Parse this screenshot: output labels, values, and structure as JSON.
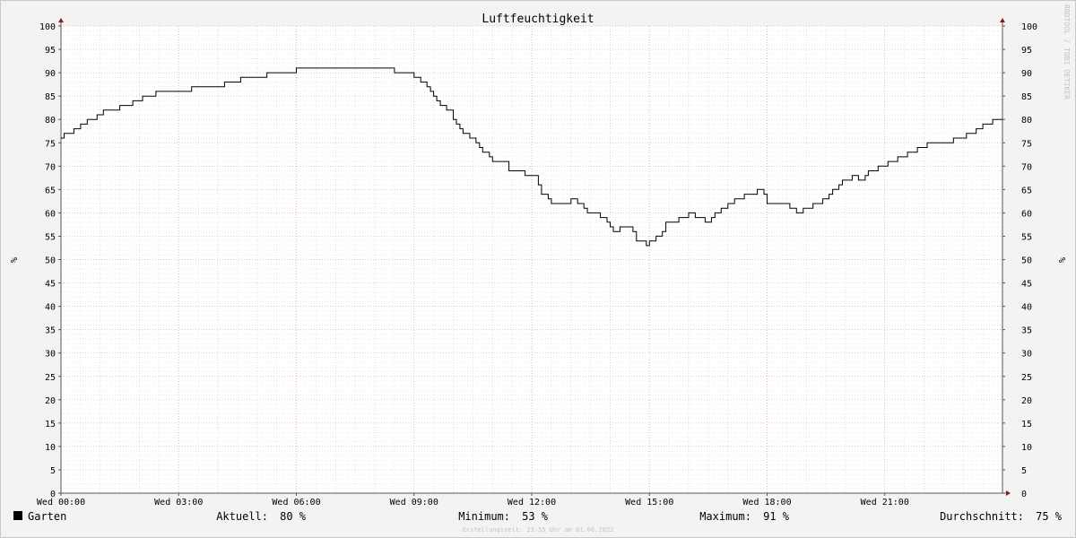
{
  "chart_data": {
    "type": "line",
    "title": "Luftfeuchtigkeit",
    "ylabel": "%",
    "ylabel_right": "%",
    "watermark": "RRDTOOL / TOBI OETIKER",
    "ylim": [
      0,
      100
    ],
    "y_ticks": [
      0,
      5,
      10,
      15,
      20,
      25,
      30,
      35,
      40,
      45,
      50,
      55,
      60,
      65,
      70,
      75,
      80,
      85,
      90,
      95,
      100
    ],
    "xlim_hours": [
      0,
      24
    ],
    "x_ticks": [
      {
        "label": "Wed 00:00",
        "hour": 0
      },
      {
        "label": "Wed 03:00",
        "hour": 3
      },
      {
        "label": "Wed 06:00",
        "hour": 6
      },
      {
        "label": "Wed 09:00",
        "hour": 9
      },
      {
        "label": "Wed 12:00",
        "hour": 12
      },
      {
        "label": "Wed 15:00",
        "hour": 15
      },
      {
        "label": "Wed 18:00",
        "hour": 18
      },
      {
        "label": "Wed 21:00",
        "hour": 21
      }
    ],
    "grid": true,
    "series": [
      {
        "name": "Garten",
        "color": "#000000",
        "points": [
          [
            0.0,
            76
          ],
          [
            0.08,
            77
          ],
          [
            0.33,
            78
          ],
          [
            0.5,
            79
          ],
          [
            0.67,
            80
          ],
          [
            0.92,
            81
          ],
          [
            1.08,
            82
          ],
          [
            1.5,
            83
          ],
          [
            1.83,
            84
          ],
          [
            2.08,
            85
          ],
          [
            2.42,
            86
          ],
          [
            3.33,
            87
          ],
          [
            4.17,
            88
          ],
          [
            4.58,
            89
          ],
          [
            5.25,
            90
          ],
          [
            6.0,
            91
          ],
          [
            8.5,
            90
          ],
          [
            9.0,
            89
          ],
          [
            9.17,
            88
          ],
          [
            9.33,
            87
          ],
          [
            9.42,
            86
          ],
          [
            9.5,
            85
          ],
          [
            9.58,
            84
          ],
          [
            9.67,
            83
          ],
          [
            9.83,
            82
          ],
          [
            10.0,
            80
          ],
          [
            10.08,
            79
          ],
          [
            10.17,
            78
          ],
          [
            10.25,
            77
          ],
          [
            10.42,
            76
          ],
          [
            10.58,
            75
          ],
          [
            10.67,
            74
          ],
          [
            10.75,
            73
          ],
          [
            10.92,
            72
          ],
          [
            11.0,
            71
          ],
          [
            11.42,
            69
          ],
          [
            11.83,
            68
          ],
          [
            12.17,
            66
          ],
          [
            12.25,
            64
          ],
          [
            12.42,
            63
          ],
          [
            12.5,
            62
          ],
          [
            13.0,
            63
          ],
          [
            13.17,
            62
          ],
          [
            13.33,
            61
          ],
          [
            13.42,
            60
          ],
          [
            13.75,
            59
          ],
          [
            13.92,
            58
          ],
          [
            14.0,
            57
          ],
          [
            14.08,
            56
          ],
          [
            14.25,
            57
          ],
          [
            14.58,
            56
          ],
          [
            14.67,
            54
          ],
          [
            14.92,
            53
          ],
          [
            15.0,
            54
          ],
          [
            15.17,
            55
          ],
          [
            15.33,
            56
          ],
          [
            15.42,
            58
          ],
          [
            15.75,
            59
          ],
          [
            16.0,
            60
          ],
          [
            16.17,
            59
          ],
          [
            16.42,
            58
          ],
          [
            16.58,
            59
          ],
          [
            16.67,
            60
          ],
          [
            16.83,
            61
          ],
          [
            17.0,
            62
          ],
          [
            17.17,
            63
          ],
          [
            17.42,
            64
          ],
          [
            17.75,
            65
          ],
          [
            17.92,
            64
          ],
          [
            18.0,
            62
          ],
          [
            18.58,
            61
          ],
          [
            18.75,
            60
          ],
          [
            18.92,
            61
          ],
          [
            19.17,
            62
          ],
          [
            19.42,
            63
          ],
          [
            19.58,
            64
          ],
          [
            19.67,
            65
          ],
          [
            19.83,
            66
          ],
          [
            19.92,
            67
          ],
          [
            20.17,
            68
          ],
          [
            20.33,
            67
          ],
          [
            20.5,
            68
          ],
          [
            20.58,
            69
          ],
          [
            20.83,
            70
          ],
          [
            21.08,
            71
          ],
          [
            21.33,
            72
          ],
          [
            21.58,
            73
          ],
          [
            21.83,
            74
          ],
          [
            22.08,
            75
          ],
          [
            22.75,
            76
          ],
          [
            23.08,
            77
          ],
          [
            23.33,
            78
          ],
          [
            23.5,
            79
          ],
          [
            23.75,
            80
          ],
          [
            24.0,
            80
          ]
        ]
      }
    ],
    "legend": {
      "series_label": "Garten",
      "aktuell_label": "Aktuell:",
      "aktuell_value": "80 %",
      "minimum_label": "Minimum:",
      "minimum_value": "53 %",
      "maximum_label": "Maximum:",
      "maximum_value": "91 %",
      "durchschnitt_label": "Durchschnitt:",
      "durchschnitt_value": "75 %"
    },
    "footer": "Erstellungszeit: 23:55 Uhr am 01.06.2022"
  }
}
